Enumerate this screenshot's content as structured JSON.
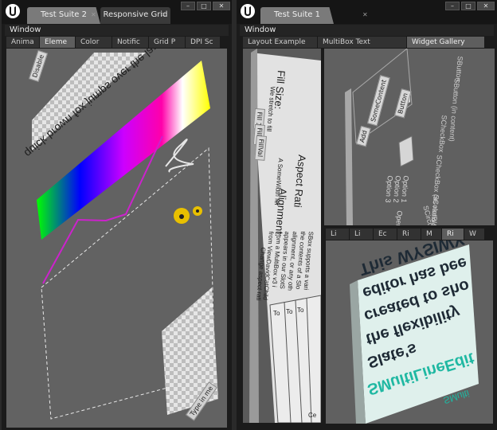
{
  "left_window": {
    "tabs": [
      {
        "label": "Test Suite 2",
        "active": true
      },
      {
        "label": "Responsive Grid",
        "active": false
      }
    ],
    "menu": "Window",
    "subtabs": [
      {
        "label": "Anima",
        "active": false
      },
      {
        "label": "Eleme",
        "active": true
      },
      {
        "label": "Color",
        "active": false
      },
      {
        "label": "Notific",
        "active": false
      },
      {
        "label": "Grid P",
        "active": false
      },
      {
        "label": "DPI Sc",
        "active": false
      }
    ],
    "content": {
      "disable_button": "Disable",
      "pangram": "quick brown fox jumps over the lazy dog",
      "text_field": "Type in me"
    }
  },
  "right_window": {
    "tabs": [
      {
        "label": "Test Suite 1",
        "active": true
      }
    ],
    "menu": "Window",
    "subtabs": [
      {
        "label": "Layout Example",
        "active": false
      },
      {
        "label": "MultiBox Text",
        "active": false
      },
      {
        "label": "Widget Gallery",
        "active": true
      }
    ],
    "layout_panel": {
      "fill_size": "Fill Size:",
      "we_stretch": "We stretch to fill",
      "fill_buttons": [
        "Fill 1",
        "Fill 1",
        "FillVal"
      ],
      "aspect_ratio": "Aspect Rati",
      "somewidth": "A  SomeWidth fer",
      "alignment": "Alignment:",
      "sbox": [
        "SBox supports a vari",
        "the contents of a Slo",
        "alignment, or any oth",
        "appears in our SlotS",
        "from a MultiBox v3 i",
        "from ViewDavidCatChild",
        "Change aspect rati"
      ],
      "grid_headers": [
        "To",
        "To",
        "To",
        "Ce"
      ]
    },
    "gallery_panel": {
      "labels": [
        "SButton",
        "SButton (in content)",
        "SCheckBox",
        "SCheckBox (as radio buttons)",
        "SColorBlock",
        "SCircularThrobber"
      ],
      "buttons": [
        "Button",
        "SomeContent",
        "Add"
      ],
      "options": [
        "Option 1",
        "Option 2",
        "Option 3"
      ],
      "open_label": "Open"
    },
    "lower_subtabs": [
      {
        "label": "Li",
        "active": false
      },
      {
        "label": "Li",
        "active": false
      },
      {
        "label": "Ec",
        "active": false
      },
      {
        "label": "Ri",
        "active": false
      },
      {
        "label": "M",
        "active": false
      },
      {
        "label": "Ri",
        "active": true
      },
      {
        "label": "W",
        "active": false
      }
    ],
    "rich_text": {
      "lines": [
        "This WYSIWY",
        "editor has bee",
        "created to sho",
        "the flexibility",
        "Slate's"
      ],
      "highlight": "SMultiLineEdit",
      "footer": "SMulti"
    }
  },
  "colors": {
    "gradient": [
      "#00ff00",
      "#0000ff",
      "#cc00ff",
      "#ff00aa",
      "#ffffff",
      "#ffff00"
    ],
    "accent_magenta": "#cc22cc",
    "throbber_yellow": "#e8c000",
    "teal_text": "#1fb8a2"
  }
}
